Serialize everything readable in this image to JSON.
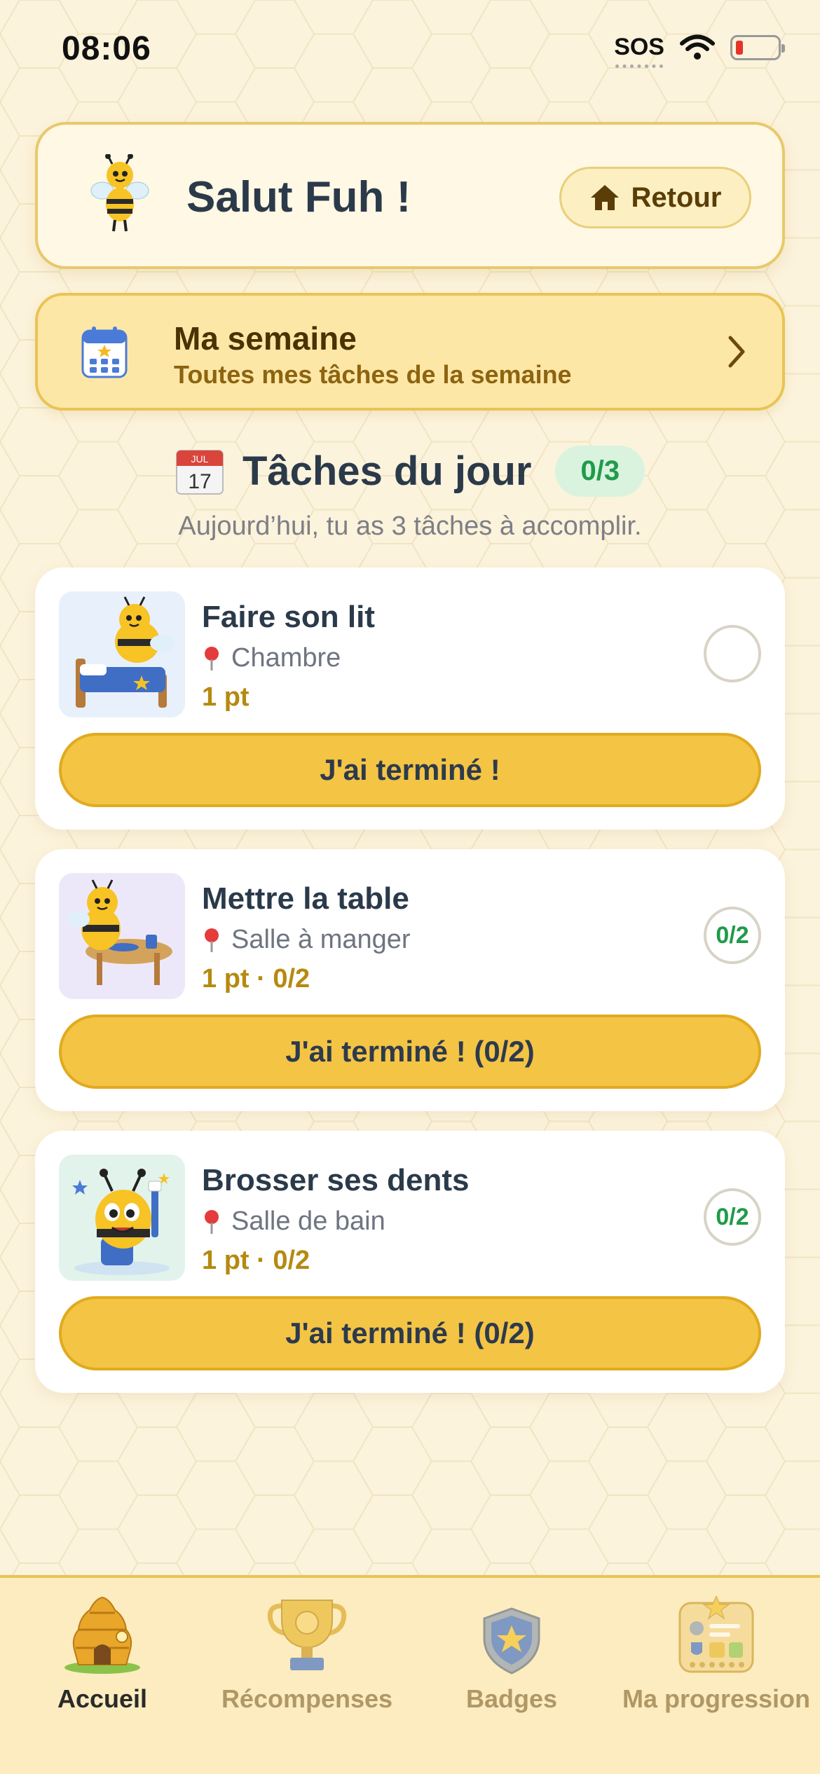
{
  "status_bar": {
    "time": "08:06",
    "sos": "SOS"
  },
  "greeting": {
    "text": "Salut Fuh !",
    "back_label": "Retour"
  },
  "week": {
    "title": "Ma semaine",
    "subtitle": "Toutes mes tâches de la semaine",
    "calendar_month": "JUL",
    "calendar_day": "17"
  },
  "today": {
    "title": "Tâches du jour",
    "count": "0/3",
    "subtitle": "Aujourd’hui, tu as 3 tâches à accomplir."
  },
  "tasks": [
    {
      "title": "Faire son lit",
      "location": "Chambre",
      "points": "1 pt",
      "check": "",
      "button": "J'ai terminé !",
      "thumb_bg": "#e8f0fb"
    },
    {
      "title": "Mettre la table",
      "location": "Salle à manger",
      "points": "1 pt · 0/2",
      "check": "0/2",
      "button": "J'ai terminé ! (0/2)",
      "thumb_bg": "#ede8f9"
    },
    {
      "title": "Brosser ses dents",
      "location": "Salle de bain",
      "points": "1 pt · 0/2",
      "check": "0/2",
      "button": "J'ai terminé ! (0/2)",
      "thumb_bg": "#e2f3ec"
    }
  ],
  "tabs": [
    {
      "label": "Accueil",
      "icon": "beehive-icon",
      "active": true
    },
    {
      "label": "Récompenses",
      "icon": "trophy-icon",
      "active": false
    },
    {
      "label": "Badges",
      "icon": "shield-star-icon",
      "active": false
    },
    {
      "label": "Ma progression",
      "icon": "progress-board-icon",
      "active": false
    }
  ],
  "colors": {
    "accent": "#f4c444",
    "background": "#fcf3dc",
    "success": "#1f9b4a",
    "text": "#2b3a4a"
  }
}
